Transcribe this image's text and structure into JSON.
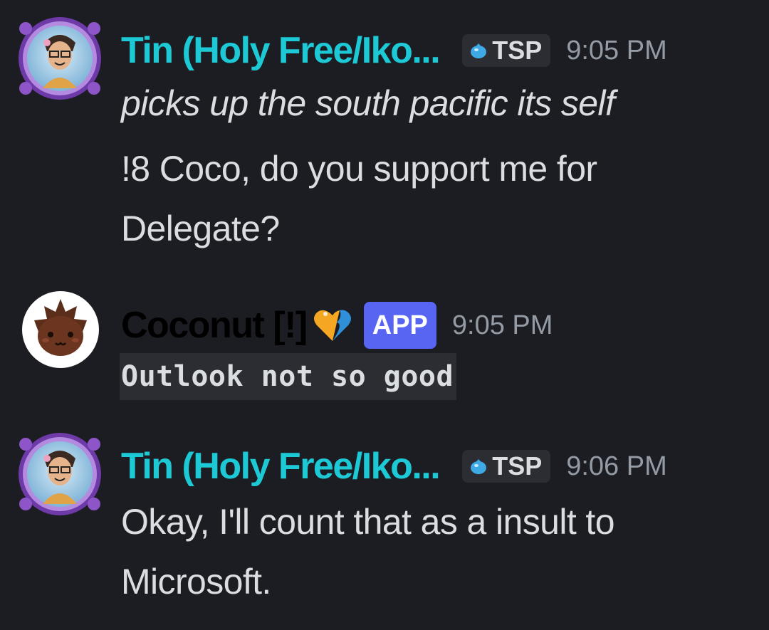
{
  "messages": [
    {
      "author": "Tin (Holy Free/Iko...",
      "tag": "TSP",
      "time": "9:05 PM",
      "lines": [
        "picks up the south pacific its self",
        "!8 Coco, do you support me for",
        "Delegate?"
      ]
    },
    {
      "author": "Coconut [!]",
      "badge": "APP",
      "time": "9:05 PM",
      "code": "Outlook not so good"
    },
    {
      "author": "Tin (Holy Free/Iko...",
      "tag": "TSP",
      "time": "9:06 PM",
      "lines": [
        "Okay, I'll count that as a insult to",
        "Microsoft."
      ]
    }
  ],
  "colors": {
    "background": "#1c1d22",
    "tin_name": "#1ec9d6",
    "coconut_name": "#000000",
    "app_badge": "#5865f2",
    "timestamp": "#949ba4"
  },
  "icons": [
    "user-avatar-tin",
    "water-drop-icon",
    "coconut-avatar",
    "orange-blue-heart-icon"
  ]
}
